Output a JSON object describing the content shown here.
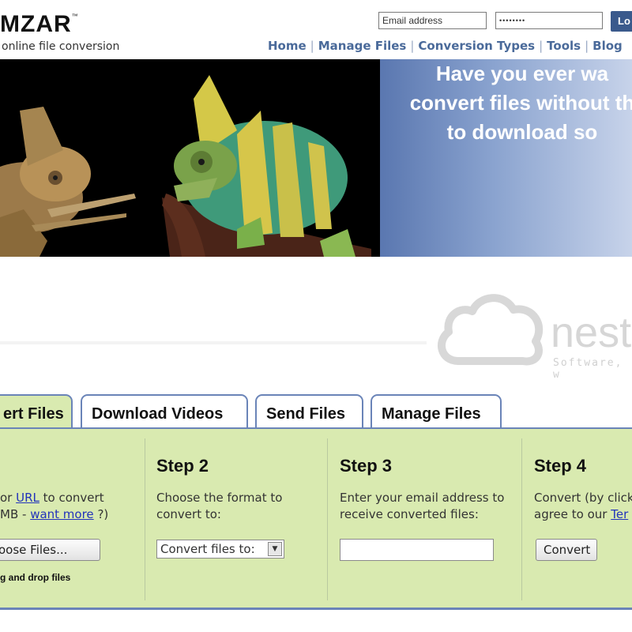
{
  "header": {
    "logo_text": "MZAR",
    "logo_tm": "™",
    "tagline": "online file conversion",
    "email_placeholder": "Email address",
    "password_mask": "••••••••",
    "login_label": "Lo"
  },
  "nav": {
    "items": [
      "Home",
      "Manage Files",
      "Conversion Types",
      "Tools",
      "Blog"
    ]
  },
  "banner": {
    "lines": [
      "Have you ever wa",
      "convert files without th",
      "to download so"
    ]
  },
  "watermark": {
    "text": "nest",
    "subtext": "Software, w"
  },
  "tabs": [
    {
      "label": "ert Files"
    },
    {
      "label": "Download Videos"
    },
    {
      "label": "Send Files"
    },
    {
      "label": "Manage Files"
    }
  ],
  "steps": {
    "step1": {
      "line1_pre": "or ",
      "line1_link": "URL",
      "line1_post": " to convert",
      "line2_pre": "MB - ",
      "line2_link": "want more",
      "line2_post": " ?)",
      "button_label": "oose Files...",
      "drag_text": "g and drop files"
    },
    "step2": {
      "title": "Step 2",
      "line1": "Choose the format to",
      "line2": "convert to:",
      "select_value": "Convert files to:"
    },
    "step3": {
      "title": "Step 3",
      "line1": "Enter your email address to",
      "line2": "receive converted files:"
    },
    "step4": {
      "title": "Step 4",
      "line1": "Convert (by click",
      "line2_pre": "agree to our ",
      "line2_link": "Ter",
      "button_label": "Convert"
    }
  }
}
